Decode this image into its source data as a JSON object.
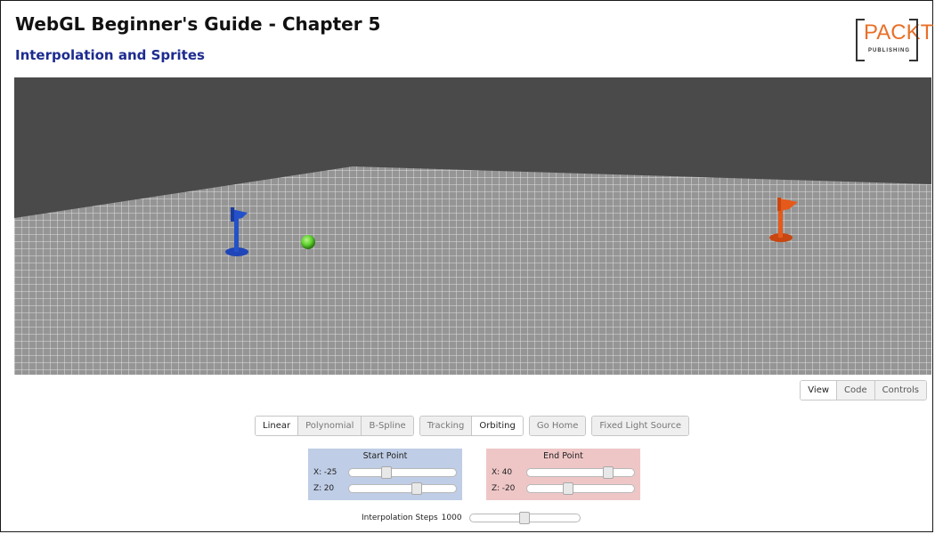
{
  "header": {
    "title": "WebGL Beginner's Guide - Chapter 5",
    "subtitle": "Interpolation and Sprites"
  },
  "logo": {
    "word": "PACKT",
    "sub": "PUBLISHING"
  },
  "scene": {
    "background_color": "#4a4a4a",
    "floor_color": "#8a8a8a",
    "grid_color": "#d8d8d8",
    "objects": [
      {
        "name": "start-flag",
        "color": "#2451c9"
      },
      {
        "name": "moving-ball",
        "color": "#5fd02e"
      },
      {
        "name": "end-flag",
        "color": "#e55a1b"
      }
    ]
  },
  "view_tabs": [
    {
      "label": "View",
      "active": true
    },
    {
      "label": "Code",
      "active": false
    },
    {
      "label": "Controls",
      "active": false
    }
  ],
  "buttons": {
    "interpolation": [
      {
        "label": "Linear",
        "active": true
      },
      {
        "label": "Polynomial",
        "active": false
      },
      {
        "label": "B-Spline",
        "active": false
      }
    ],
    "camera": [
      {
        "label": "Tracking",
        "active": false
      },
      {
        "label": "Orbiting",
        "active": true
      }
    ],
    "go_home": "Go Home",
    "fixed_light": "Fixed Light Source"
  },
  "start_point": {
    "title": "Start Point",
    "x_label": "X:",
    "x_value": "-25",
    "x_slider_fraction": 0.35,
    "z_label": "Z:",
    "z_value": "20",
    "z_slider_fraction": 0.63,
    "color": "#bfcde6"
  },
  "end_point": {
    "title": "End Point",
    "x_label": "X:",
    "x_value": "40",
    "x_slider_fraction": 0.76,
    "z_label": "Z:",
    "z_value": "-20",
    "z_slider_fraction": 0.38,
    "color": "#efc6c6"
  },
  "interpolation_steps": {
    "label": "Interpolation Steps",
    "value": "1000",
    "slider_fraction": 0.5
  }
}
